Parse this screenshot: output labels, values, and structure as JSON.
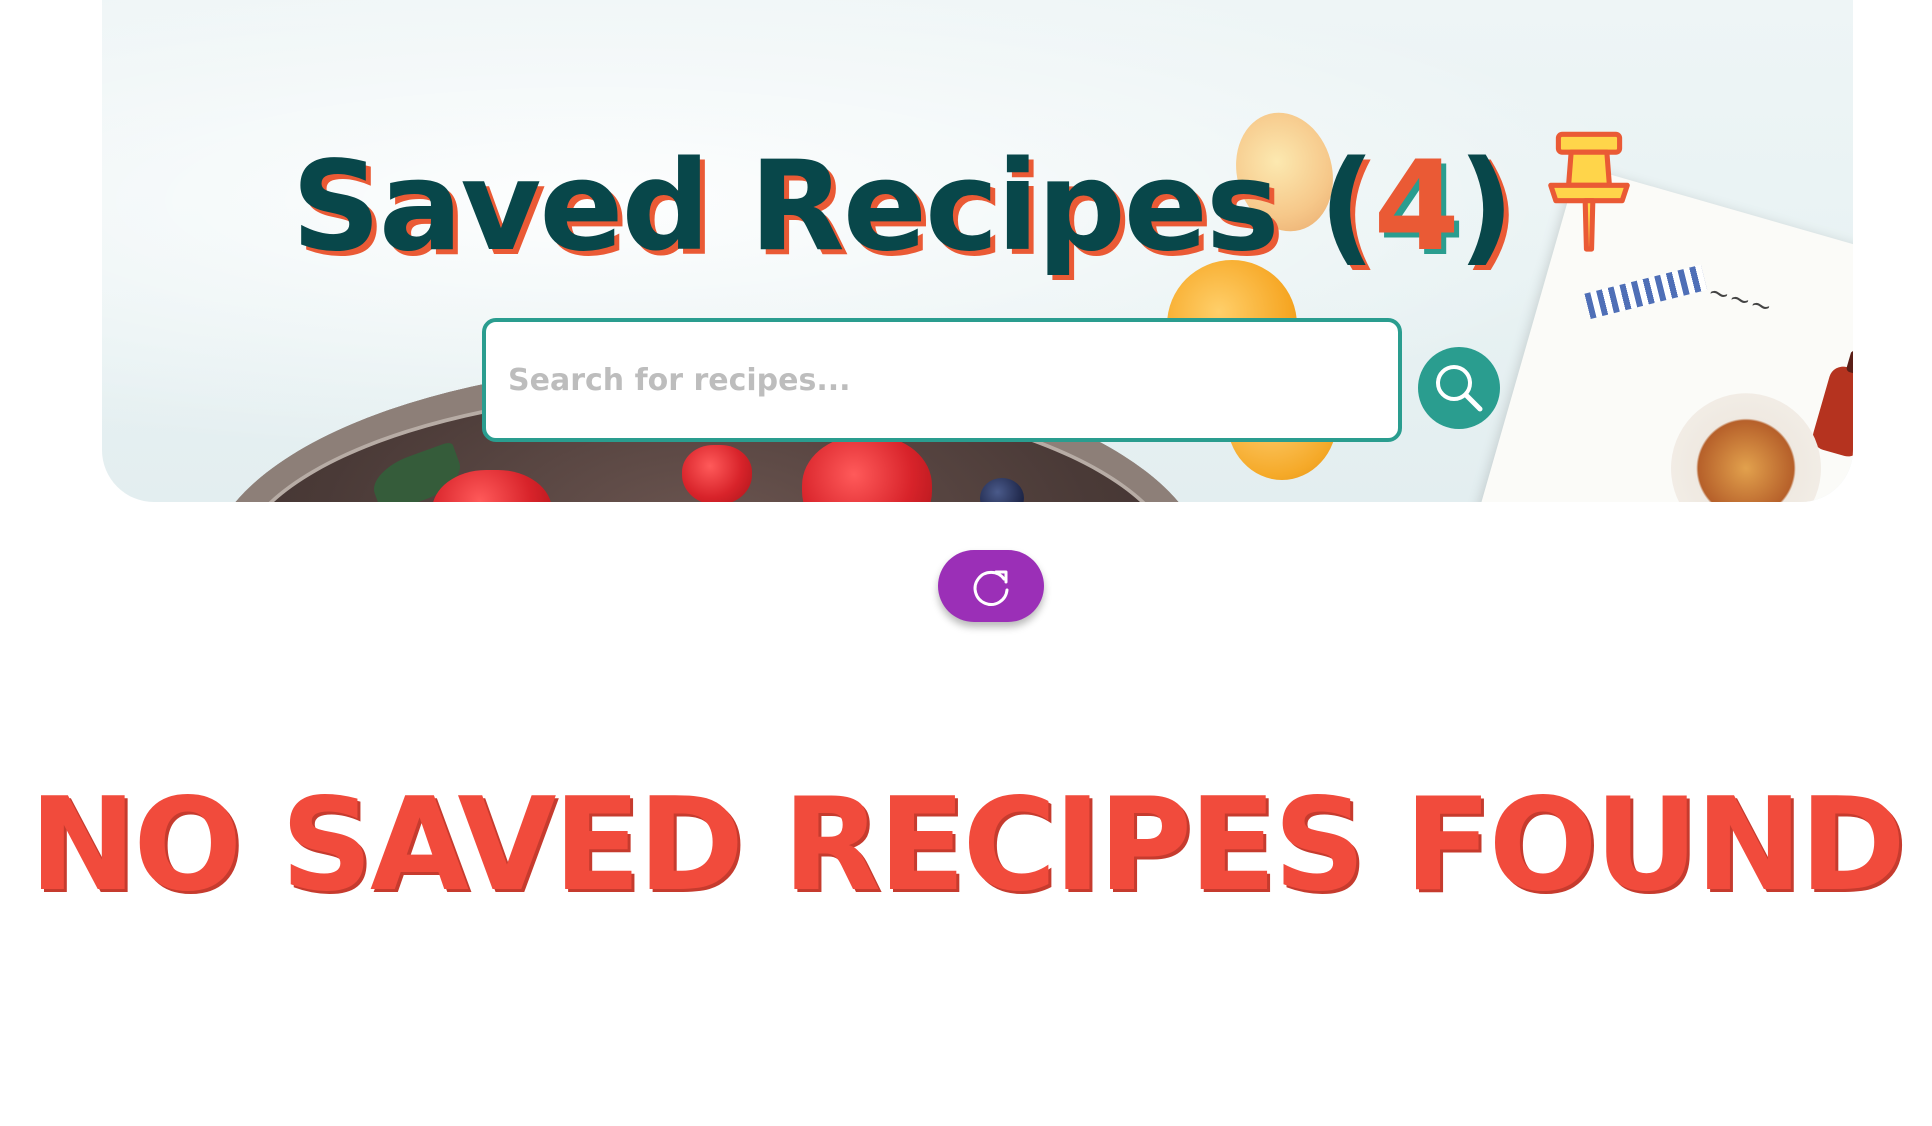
{
  "header": {
    "title": "Saved Recipes",
    "open_paren": "(",
    "count": "4",
    "close_paren": ")",
    "pin_icon": "pushpin-icon"
  },
  "search": {
    "placeholder": "Search for recipes...",
    "value": "",
    "button_icon": "search-icon"
  },
  "refresh": {
    "icon": "refresh-icon"
  },
  "empty_state": {
    "message": "NO SAVED RECIPES FOUND"
  },
  "colors": {
    "title": "#08474a",
    "title_shadow": "#ea5a35",
    "accent_teal": "#2a9d8f",
    "refresh_purple": "#9b2fb7",
    "empty_red": "#f14b3c",
    "pin_yellow": "#ffd54a"
  }
}
